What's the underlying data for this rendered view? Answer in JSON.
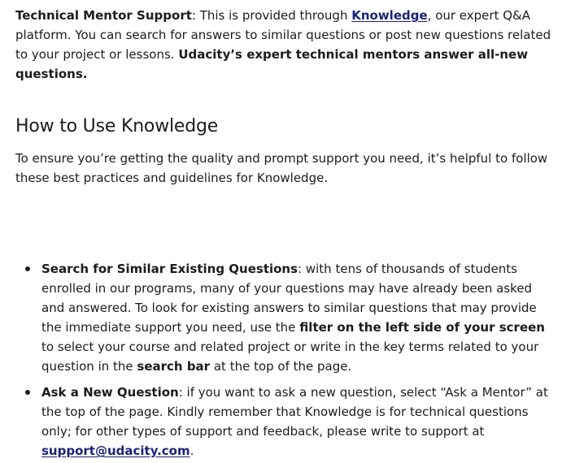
{
  "intro": {
    "label": "Technical Mentor Support",
    "sep": ": ",
    "text_before_link": "This is provided through ",
    "link_text": "Knowledge",
    "text_after_link": ", our expert Q&A platform. You can search for answers to similar questions or post new questions related to your project or lessons. ",
    "bold_text": "Udacity’s expert technical mentors answer all-new questions."
  },
  "section": {
    "heading": "How to Use Knowledge",
    "description": "To ensure you’re getting the quality and prompt support you need, it’s helpful to follow these best practices and guidelines for Knowledge."
  },
  "list": {
    "item1": {
      "label": "Search for Similar Existing Questions",
      "text1": ": with tens of thousands of students enrolled in our programs, many of your questions may have already been asked and answered. To look for existing answers to similar questions that may provide the immediate support you need, use the ",
      "bold1": "filter on the left side of your screen",
      "text2": " to select your course and related project or write in the key terms related to your question in the ",
      "bold2": "search bar",
      "text3": " at the top of the page."
    },
    "item2": {
      "label": "Ask a New Question",
      "text1": ": if you want to ask a new question, select “Ask a Mentor” at the top of the page. Kindly remember that Knowledge is for technical questions only; for other types of support and feedback, please write to support at ",
      "email": "support@udacity.com",
      "text2": "."
    }
  },
  "colors": {
    "text": "#1c1c1c",
    "link": "#1b237a",
    "background": "#ffffff"
  }
}
